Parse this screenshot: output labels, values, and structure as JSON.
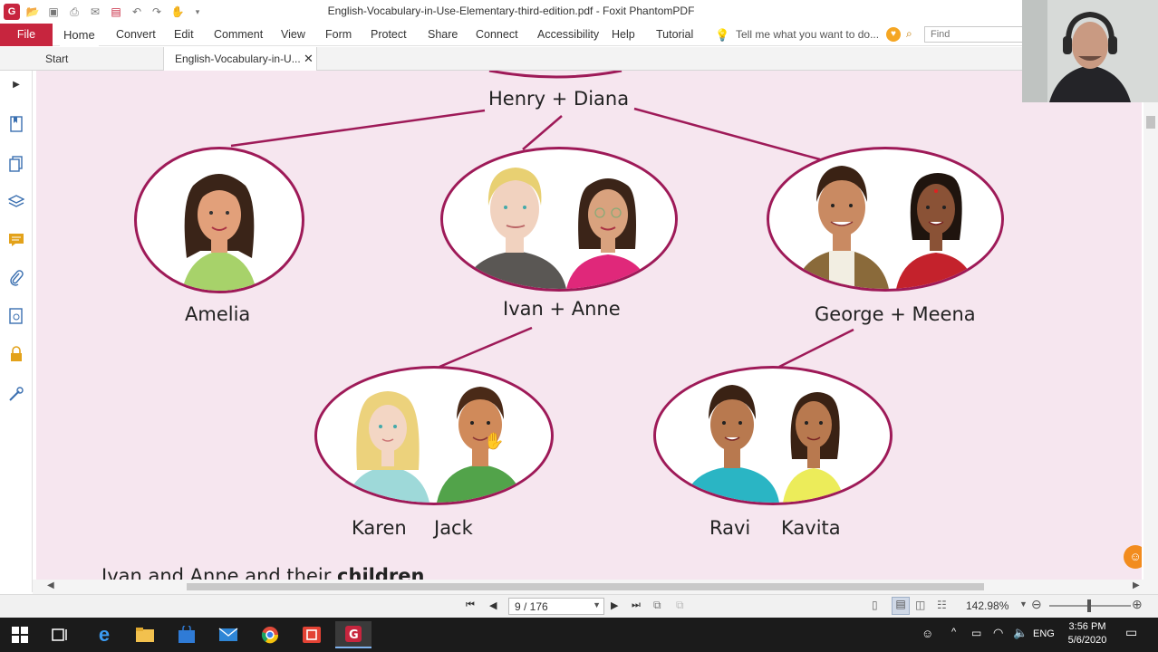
{
  "window": {
    "title": "English-Vocabulary-in-Use-Elementary-third-edition.pdf - Foxit PhantomPDF"
  },
  "ribbon": {
    "tabs": [
      "File",
      "Home",
      "Convert",
      "Edit",
      "Comment",
      "View",
      "Form",
      "Protect",
      "Share",
      "Connect",
      "Accessibility",
      "Help",
      "Tutorial"
    ],
    "tell_me": "Tell me what you want to do...",
    "find_placeholder": "Find"
  },
  "doc_tabs": {
    "start": "Start",
    "current": "English-Vocabulary-in-U..."
  },
  "family_tree": {
    "top_couple": "Henry + Diana",
    "child1": "Amelia",
    "child2": "Ivan + Anne",
    "child3": "George + Meena",
    "grandchildren_left_1": "Karen",
    "grandchildren_left_2": "Jack",
    "grandchildren_right_1": "Ravi",
    "grandchildren_right_2": "Kavita",
    "caption_prefix": "Ivan and Anne and their",
    "caption_bold": "children"
  },
  "statusbar": {
    "page_indicator": "9 / 176",
    "zoom": "142.98%"
  },
  "taskbar": {
    "time": "3:56 PM",
    "date": "5/6/2020",
    "language": "ENG"
  },
  "colors": {
    "accent": "#c7253e",
    "tree_line": "#9e1a58",
    "page_bg": "#f6e6ef"
  }
}
